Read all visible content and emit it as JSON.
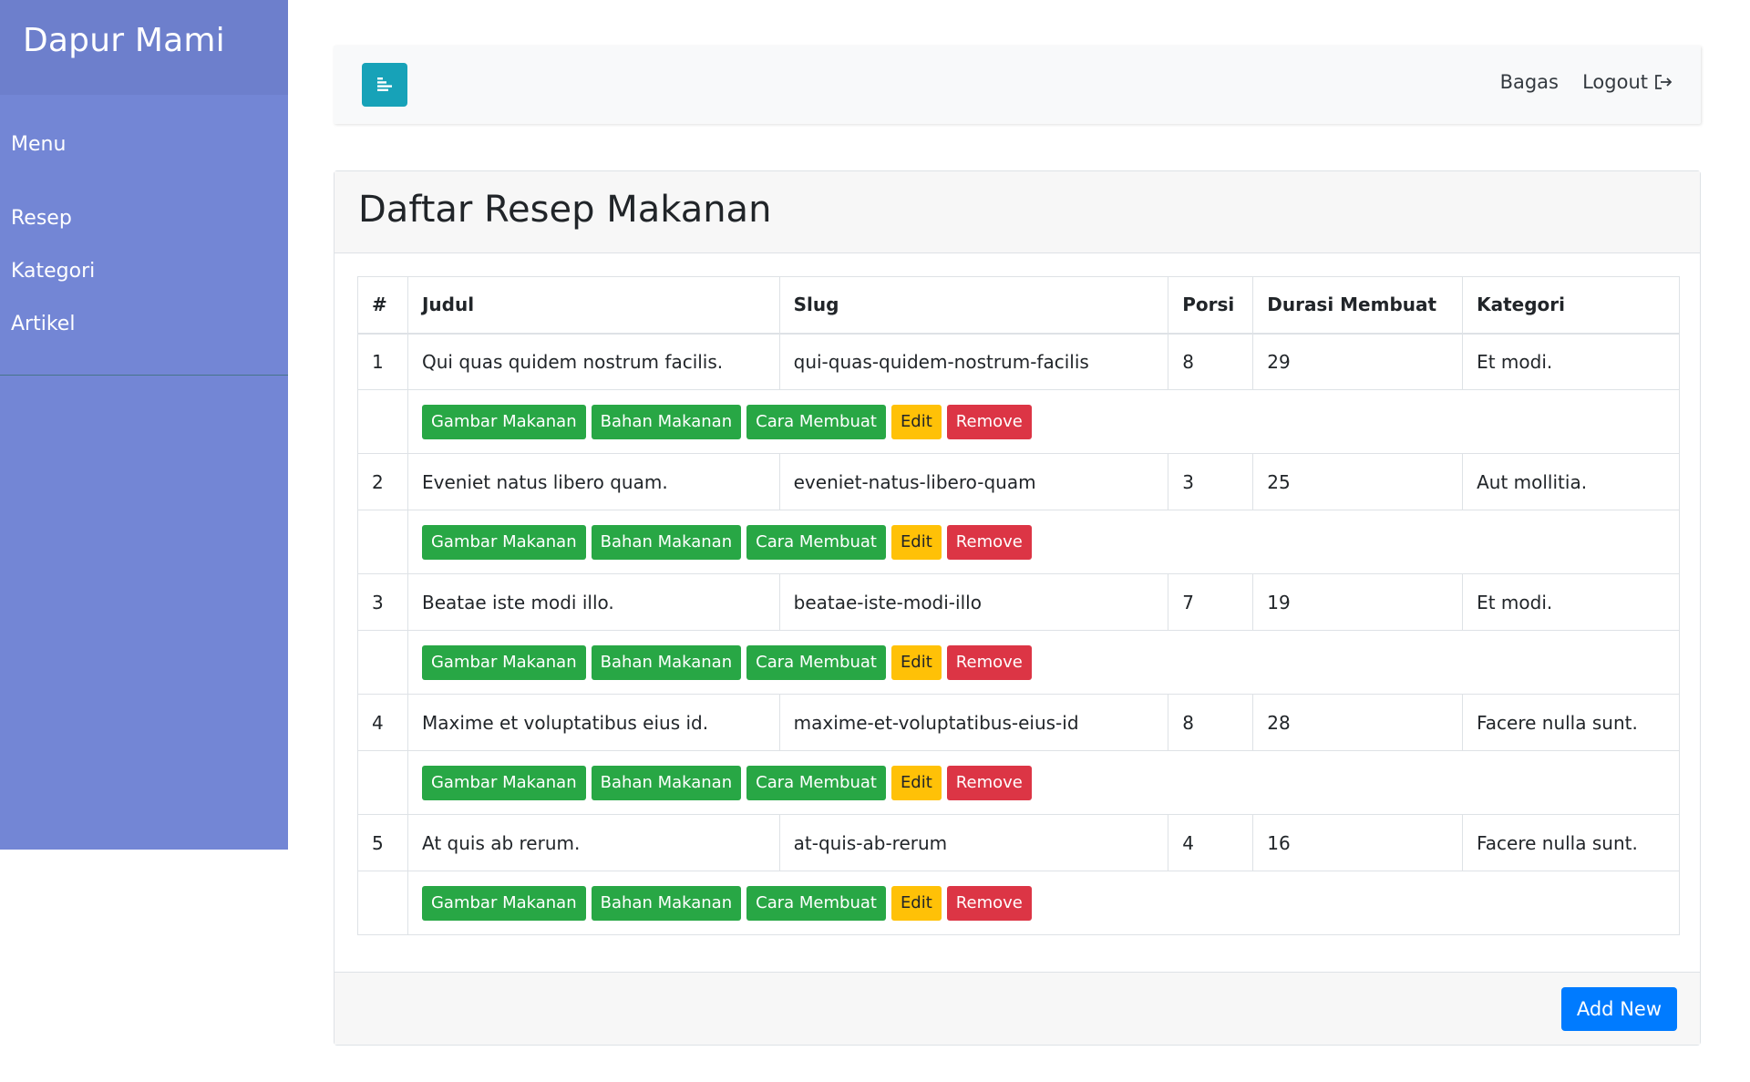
{
  "sidebar": {
    "brand": "Dapur Mami",
    "menu_title": "Menu",
    "items": [
      {
        "label": "Resep"
      },
      {
        "label": "Kategori"
      },
      {
        "label": "Artikel"
      }
    ]
  },
  "topbar": {
    "toggle_icon": "align-left-icon",
    "user": "Bagas",
    "logout": "Logout",
    "logout_icon": "sign-out-icon"
  },
  "page": {
    "title": "Daftar Resep Makanan"
  },
  "table": {
    "headers": [
      "#",
      "Judul",
      "Slug",
      "Porsi",
      "Durasi Membuat",
      "Kategori"
    ],
    "rows": [
      {
        "num": "1",
        "judul": "Qui quas quidem nostrum facilis.",
        "slug": "qui-quas-quidem-nostrum-facilis",
        "porsi": "8",
        "durasi": "29",
        "kategori": "Et modi."
      },
      {
        "num": "2",
        "judul": "Eveniet natus libero quam.",
        "slug": "eveniet-natus-libero-quam",
        "porsi": "3",
        "durasi": "25",
        "kategori": "Aut mollitia."
      },
      {
        "num": "3",
        "judul": "Beatae iste modi illo.",
        "slug": "beatae-iste-modi-illo",
        "porsi": "7",
        "durasi": "19",
        "kategori": "Et modi."
      },
      {
        "num": "4",
        "judul": "Maxime et voluptatibus eius id.",
        "slug": "maxime-et-voluptatibus-eius-id",
        "porsi": "8",
        "durasi": "28",
        "kategori": "Facere nulla sunt."
      },
      {
        "num": "5",
        "judul": "At quis ab rerum.",
        "slug": "at-quis-ab-rerum",
        "porsi": "4",
        "durasi": "16",
        "kategori": "Facere nulla sunt."
      }
    ],
    "actions": {
      "gambar": "Gambar Makanan",
      "bahan": "Bahan Makanan",
      "cara": "Cara Membuat",
      "edit": "Edit",
      "remove": "Remove"
    }
  },
  "footer": {
    "add_label": "Add New"
  },
  "colors": {
    "sidebar": "#7386d5",
    "sidebar_header": "#6d7fcc",
    "toggle": "#17a2b8",
    "success": "#28a745",
    "warning": "#ffc107",
    "danger": "#dc3545",
    "primary": "#007bff"
  }
}
